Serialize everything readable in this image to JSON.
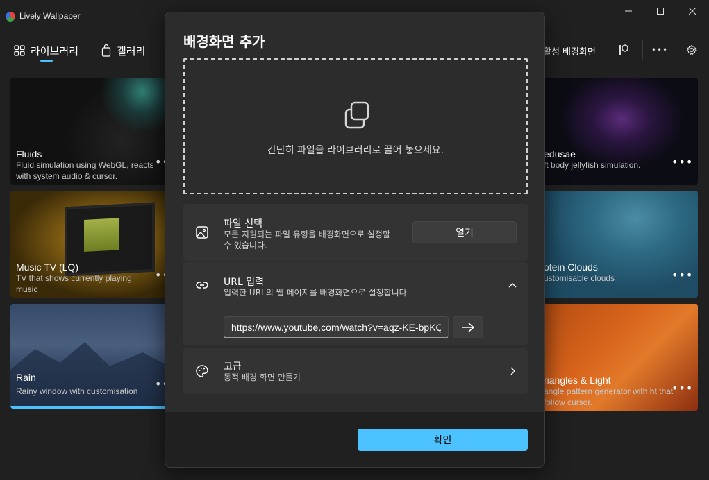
{
  "window": {
    "title": "Lively Wallpaper",
    "controls": {
      "minimize": "—",
      "maximize": "☐",
      "close": "✕"
    }
  },
  "nav": {
    "library_label": "라이브러리",
    "gallery_label": "갤러리",
    "active_wallpaper_label": "활성 배경화면",
    "more_label": "•••"
  },
  "cards": [
    {
      "title": "Fluids",
      "desc": "Fluid simulation using WebGL, reacts with system audio & cursor.",
      "more": "•••"
    },
    {
      "title": "Music TV (LQ)",
      "desc": "TV that shows currently playing music",
      "more": "•••"
    },
    {
      "title": "Rain",
      "desc": "Rainy window with customisation",
      "more": "•••"
    },
    {
      "title": "edusae",
      "desc": "ft body jellyfish simulation.",
      "more": "•••"
    },
    {
      "title": "otein Clouds",
      "desc": "ustomisable clouds",
      "more": "•••"
    },
    {
      "title": "riangles & Light",
      "desc": "angle pattern generator with ht that follow cursor.",
      "more": "•••"
    }
  ],
  "dialog": {
    "title": "배경화면 추가",
    "dropzone_text": "간단히 파일을 라이브러리로 끌어 놓으세요.",
    "file": {
      "label": "파일 선택",
      "desc": "모든 지원되는 파일 유형을 배경화면으로 설정할 수 있습니다.",
      "open_button": "열기"
    },
    "url": {
      "label": "URL 입력",
      "desc": "입력한 URL의 웹 페이지를 배경화면으로 설정합니다.",
      "value": "https://www.youtube.com/watch?v=aqz-KE-bpKQ"
    },
    "advanced": {
      "label": "고급",
      "desc": "동적 배경 화면 만들기"
    },
    "confirm_button": "확인"
  },
  "colors": {
    "accent": "#4cc2ff",
    "dialog_bg": "#2c2c2c",
    "panel_bg": "#333333",
    "window_bg": "#202020"
  }
}
